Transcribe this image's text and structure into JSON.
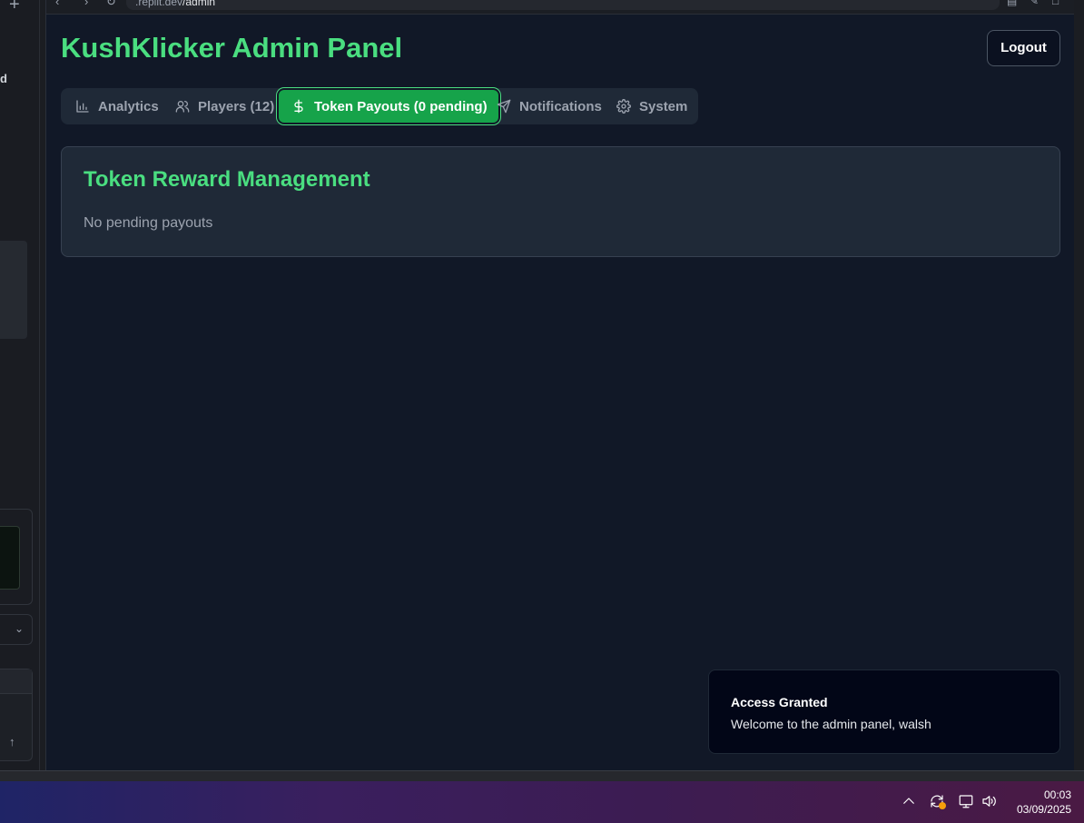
{
  "browser": {
    "url_host": ".replit.dev",
    "url_path": "/admin"
  },
  "left_window": {
    "partial_text": "d"
  },
  "header": {
    "title": "KushKlicker Admin Panel",
    "logout_label": "Logout"
  },
  "tabs": [
    {
      "label": "Analytics",
      "icon": "bar-chart-icon",
      "active": false
    },
    {
      "label": "Players (12)",
      "icon": "users-icon",
      "active": false
    },
    {
      "label": "Token Payouts (0 pending)",
      "icon": "dollar-icon",
      "active": true
    },
    {
      "label": "Notifications",
      "icon": "send-icon",
      "active": false
    },
    {
      "label": "System",
      "icon": "gear-icon",
      "active": false
    }
  ],
  "card": {
    "title": "Token Reward Management",
    "empty_message": "No pending payouts"
  },
  "toast": {
    "title": "Access Granted",
    "message": "Welcome to the admin panel, walsh"
  },
  "taskbar": {
    "time": "00:03",
    "date": "03/09/2025"
  },
  "colors": {
    "accent": "#4ade80",
    "active_tab": "#16a34a",
    "background": "#111827",
    "card": "#1f2937"
  }
}
